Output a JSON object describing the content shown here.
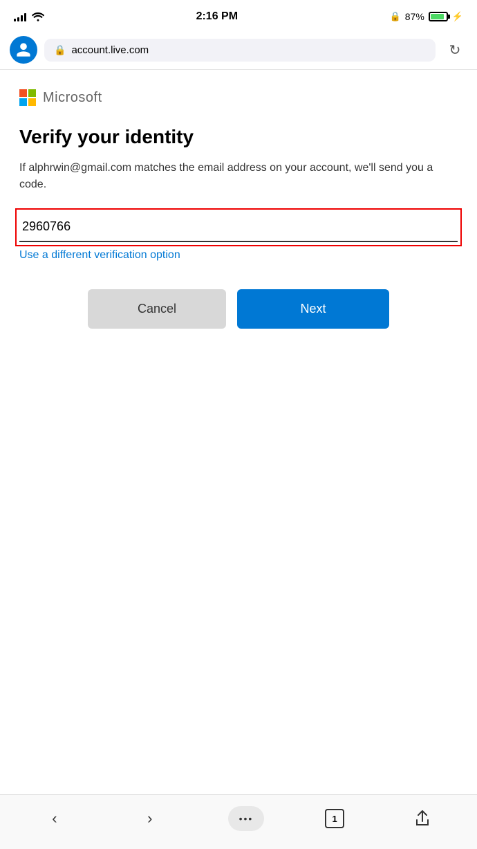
{
  "statusBar": {
    "time": "2:16 PM",
    "batteryPercent": "87%",
    "batteryCharging": true
  },
  "browserBar": {
    "url": "account.live.com",
    "refreshLabel": "↻"
  },
  "microsoftBrand": {
    "name": "Microsoft"
  },
  "page": {
    "title": "Verify your identity",
    "description": "If alphrwin@gmail.com matches the email address on your account, we'll send you a code.",
    "inputValue": "2960766",
    "inputPlaceholder": "",
    "differentOptionLink": "Use a different verification option",
    "cancelButton": "Cancel",
    "nextButton": "Next"
  },
  "bottomNav": {
    "backLabel": "‹",
    "forwardLabel": "›",
    "moreLabel": "•••",
    "tabCount": "1",
    "shareLabel": "⬆"
  }
}
